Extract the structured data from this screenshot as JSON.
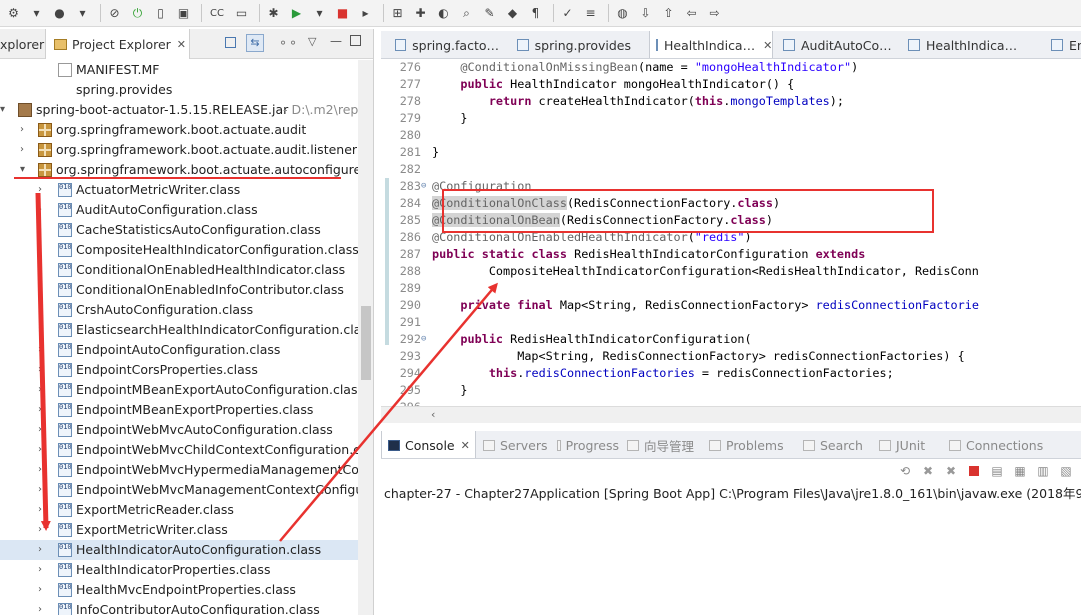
{
  "colors": {
    "annotation_red": "#e8322f",
    "keyword": "#7f0055",
    "annotation": "#646464",
    "string": "#2a00ff",
    "field": "#0000c0"
  },
  "toolbar": {
    "icons": [
      "debug-icon",
      "debug-config-icon",
      "profile-icon",
      "settings-icon",
      "skip-breakpoints-icon",
      "spring-boot-icon",
      "toggle-icon",
      "terminal-icon",
      "cc-label",
      "folder-icon",
      "bug-icon",
      "run-icon",
      "run-config-icon",
      "stop-icon",
      "build-icon",
      "new-package-icon",
      "new-class-icon",
      "open-type-icon",
      "search-icon",
      "pencil-icon",
      "marker-icon",
      "annotation-icon",
      "pin-icon",
      "format-icon",
      "globe-icon",
      "next-annotation-icon",
      "prev-annotation-icon",
      "back-icon",
      "forward-icon"
    ],
    "cc_label": "CC"
  },
  "left_pane": {
    "tabs": [
      {
        "label": "xplorer"
      },
      {
        "label": "Project Explorer"
      }
    ],
    "tree": [
      {
        "label": "MANIFEST.MF",
        "icon": "file",
        "arrow": ""
      },
      {
        "label": "spring.provides",
        "icon": "none",
        "arrow": ""
      },
      {
        "label": "spring-boot-actuator-1.5.15.RELEASE.jar",
        "suffix": "- D:\\.m2\\repos",
        "icon": "jar",
        "arrow": "▾"
      },
      {
        "label": "org.springframework.boot.actuate.audit",
        "icon": "pkg",
        "arrow": "›"
      },
      {
        "label": "org.springframework.boot.actuate.audit.listener",
        "icon": "pkg",
        "arrow": "›"
      },
      {
        "label": "org.springframework.boot.actuate.autoconfigure",
        "icon": "pkg",
        "arrow": "▾"
      },
      {
        "label": "ActuatorMetricWriter.class",
        "icon": "cls",
        "arrow": "›"
      },
      {
        "label": "AuditAutoConfiguration.class",
        "icon": "cls",
        "arrow": "›"
      },
      {
        "label": "CacheStatisticsAutoConfiguration.class",
        "icon": "cls",
        "arrow": "›"
      },
      {
        "label": "CompositeHealthIndicatorConfiguration.class",
        "icon": "cls",
        "arrow": "›"
      },
      {
        "label": "ConditionalOnEnabledHealthIndicator.class",
        "icon": "cls",
        "arrow": "›"
      },
      {
        "label": "ConditionalOnEnabledInfoContributor.class",
        "icon": "cls",
        "arrow": "›"
      },
      {
        "label": "CrshAutoConfiguration.class",
        "icon": "cls",
        "arrow": "›"
      },
      {
        "label": "ElasticsearchHealthIndicatorConfiguration.class",
        "icon": "cls",
        "arrow": "›"
      },
      {
        "label": "EndpointAutoConfiguration.class",
        "icon": "cls",
        "arrow": "›"
      },
      {
        "label": "EndpointCorsProperties.class",
        "icon": "cls",
        "arrow": "›"
      },
      {
        "label": "EndpointMBeanExportAutoConfiguration.class",
        "icon": "cls",
        "arrow": "›"
      },
      {
        "label": "EndpointMBeanExportProperties.class",
        "icon": "cls",
        "arrow": "›"
      },
      {
        "label": "EndpointWebMvcAutoConfiguration.class",
        "icon": "cls",
        "arrow": "›"
      },
      {
        "label": "EndpointWebMvcChildContextConfiguration.clas",
        "icon": "cls",
        "arrow": "›"
      },
      {
        "label": "EndpointWebMvcHypermediaManagementConte",
        "icon": "cls",
        "arrow": "›"
      },
      {
        "label": "EndpointWebMvcManagementContextConfigura",
        "icon": "cls",
        "arrow": "›"
      },
      {
        "label": "ExportMetricReader.class",
        "icon": "cls",
        "arrow": "›"
      },
      {
        "label": "ExportMetricWriter.class",
        "icon": "cls",
        "arrow": "›"
      },
      {
        "label": "HealthIndicatorAutoConfiguration.class",
        "icon": "cls",
        "arrow": "›",
        "selected": true
      },
      {
        "label": "HealthIndicatorProperties.class",
        "icon": "cls",
        "arrow": "›"
      },
      {
        "label": "HealthMvcEndpointProperties.class",
        "icon": "cls",
        "arrow": "›"
      },
      {
        "label": "InfoContributorAutoConfiguration.class",
        "icon": "cls",
        "arrow": "›"
      }
    ]
  },
  "editor": {
    "tabs": [
      {
        "label": "spring.facto…",
        "active": false
      },
      {
        "label": "spring.provides",
        "active": false
      },
      {
        "label": "HealthIndica…",
        "active": true
      },
      {
        "label": "AuditAutoCo…",
        "active": false
      },
      {
        "label": "HealthIndica…",
        "active": false
      },
      {
        "label": "En",
        "active": false
      }
    ],
    "lines": [
      {
        "n": "276",
        "fold": "",
        "t": "    @ConditionalOnMissingBean(name = \"mongoHealthIndicator\")"
      },
      {
        "n": "277",
        "fold": "",
        "t": "    public HealthIndicator mongoHealthIndicator() {"
      },
      {
        "n": "278",
        "fold": "",
        "t": "        return createHealthIndicator(this.mongoTemplates);"
      },
      {
        "n": "279",
        "fold": "",
        "t": "    }"
      },
      {
        "n": "280",
        "fold": "",
        "t": ""
      },
      {
        "n": "281",
        "fold": "",
        "t": "}"
      },
      {
        "n": "282",
        "fold": "",
        "t": ""
      },
      {
        "n": "283",
        "fold": "⊖",
        "t": "@Configuration"
      },
      {
        "n": "284",
        "fold": "",
        "t": "@ConditionalOnClass(RedisConnectionFactory.class)"
      },
      {
        "n": "285",
        "fold": "",
        "t": "@ConditionalOnBean(RedisConnectionFactory.class)"
      },
      {
        "n": "286",
        "fold": "",
        "t": "@ConditionalOnEnabledHealthIndicator(\"redis\")"
      },
      {
        "n": "287",
        "fold": "",
        "t": "public static class RedisHealthIndicatorConfiguration extends"
      },
      {
        "n": "288",
        "fold": "",
        "t": "        CompositeHealthIndicatorConfiguration<RedisHealthIndicator, RedisConn"
      },
      {
        "n": "289",
        "fold": "",
        "t": ""
      },
      {
        "n": "290",
        "fold": "",
        "t": "    private final Map<String, RedisConnectionFactory> redisConnectionFactorie"
      },
      {
        "n": "291",
        "fold": "",
        "t": ""
      },
      {
        "n": "292",
        "fold": "⊖",
        "t": "    public RedisHealthIndicatorConfiguration("
      },
      {
        "n": "293",
        "fold": "",
        "t": "            Map<String, RedisConnectionFactory> redisConnectionFactories) {"
      },
      {
        "n": "294",
        "fold": "",
        "t": "        this.redisConnectionFactories = redisConnectionFactories;"
      },
      {
        "n": "295",
        "fold": "",
        "t": "    }"
      },
      {
        "n": "296",
        "fold": "",
        "t": ""
      }
    ]
  },
  "console": {
    "tabs": [
      {
        "label": "Console",
        "active": true
      },
      {
        "label": "Servers",
        "active": false
      },
      {
        "label": "Progress",
        "active": false
      },
      {
        "label": "向导管理",
        "active": false
      },
      {
        "label": "Problems",
        "active": false
      },
      {
        "label": "Search",
        "active": false
      },
      {
        "label": "JUnit",
        "active": false
      },
      {
        "label": "Connections",
        "active": false
      }
    ],
    "status": "chapter-27 - Chapter27Application [Spring Boot App] C:\\Program Files\\Java\\jre1.8.0_161\\bin\\javaw.exe (2018年9月11日 上"
  }
}
